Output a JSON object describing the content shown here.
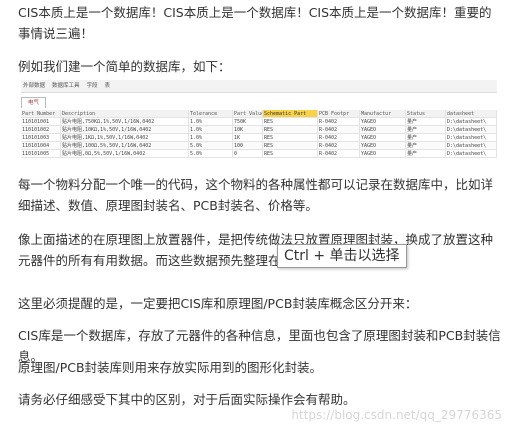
{
  "paragraphs": {
    "p1": "CIS本质上是一个数据库！CIS本质上是一个数据库！CIS本质上是一个数据库！重要的事情说三遍！",
    "p2": "例如我们建一个简单的数据库，如下：",
    "p3": "每一个物料分配一个唯一的代码，这个物料的各种属性都可以记录在数据库中，比如详细描述、数值、原理图封装名、PCB封装名、价格等。",
    "p4": "像上面描述的在原理图上放置器件，是把传统做法只放置原理图封装，换成了放置这种元器件的所有有用数据。而这些数据预先整理在了上面的数据库中。",
    "p5": "这里必须提醒的是，一定要把CIS库和原理图/PCB封装库概念区分开来：",
    "p6": "CIS库是一个数据库，存放了元器件的各种信息，里面也包含了原理图封装和PCB封装信息。",
    "p7": "原理图/PCB封装库则用来存放实际用到的图形化封装。",
    "p8": "请务必仔细感受下其中的区别，对于后面实际操作会有帮助。"
  },
  "db_screenshot": {
    "menu": [
      "外部数据",
      "数据库工具",
      "字段",
      "表"
    ],
    "tab": "电气",
    "columns": [
      "Part Number",
      "Description",
      "Tolerance",
      "Part Value",
      "Schematic Part",
      "PCB Footpr",
      "Manufactur",
      "Status",
      "datasheet"
    ],
    "rows": [
      [
        "110101001",
        "贴片电阻,750KΩ,1%,50V,1/16W,0402",
        "1.0%",
        "750K",
        "RES",
        "R-0402",
        "YAGEO",
        "量产",
        "D:\\datasheet\\"
      ],
      [
        "110101002",
        "贴片电阻,10KΩ,1%,50V,1/16W,0402",
        "1.0%",
        "10K",
        "RES",
        "R-0402",
        "YAGEO",
        "量产",
        "D:\\datasheet\\"
      ],
      [
        "110101003",
        "贴片电阻,1KΩ,1%,50V,1/16W,0402",
        "1.0%",
        "1K",
        "RES",
        "R-0402",
        "YAGEO",
        "量产",
        "D:\\datasheet\\"
      ],
      [
        "110101004",
        "贴片电阻,100Ω,5%,50V,1/16W,0402",
        "5.0%",
        "100",
        "RES",
        "R-0402",
        "YAGEO",
        "量产",
        "D:\\datasheet\\"
      ],
      [
        "110101005",
        "贴片电阻,0Ω,5%,50V,1/16W,0402",
        "5.0%",
        "0",
        "RES",
        "R-0402",
        "YAGEO",
        "量产",
        "D:\\datasheet\\"
      ]
    ]
  },
  "tooltip": "Ctrl + 单击以选择",
  "watermark": "https://blog.csdn.net/qq_29776365"
}
